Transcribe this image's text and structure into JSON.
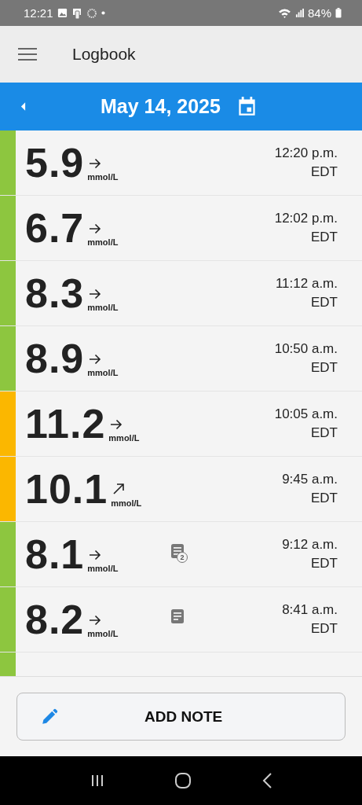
{
  "status_bar": {
    "time": "12:21",
    "battery": "84%"
  },
  "app_bar": {
    "title": "Logbook"
  },
  "date_bar": {
    "date": "May 14, 2025"
  },
  "readings": [
    {
      "kind": "full",
      "value": "5.9",
      "unit": "mmol/L",
      "trend": {
        "kind": "steady"
      },
      "time": "12:20 p.m.",
      "zone": "EDT",
      "color": "#8dc63f"
    },
    {
      "kind": "full",
      "value": "6.7",
      "unit": "mmol/L",
      "trend": {
        "kind": "steady"
      },
      "time": "12:02 p.m.",
      "zone": "EDT",
      "color": "#8dc63f"
    },
    {
      "kind": "full",
      "value": "8.3",
      "unit": "mmol/L",
      "trend": {
        "kind": "steady"
      },
      "time": "11:12 a.m.",
      "zone": "EDT",
      "color": "#8dc63f"
    },
    {
      "kind": "full",
      "value": "8.9",
      "unit": "mmol/L",
      "trend": {
        "kind": "steady"
      },
      "time": "10:50 a.m.",
      "zone": "EDT",
      "color": "#8dc63f"
    },
    {
      "kind": "full",
      "value": "11.2",
      "unit": "mmol/L",
      "trend": {
        "kind": "steady"
      },
      "time": "10:05 a.m.",
      "zone": "EDT",
      "color": "#fbb700"
    },
    {
      "kind": "full",
      "value": "10.1",
      "unit": "mmol/L",
      "trend": {
        "kind": "rising"
      },
      "time": "9:45 a.m.",
      "zone": "EDT",
      "color": "#fbb700"
    },
    {
      "kind": "full",
      "value": "8.1",
      "unit": "mmol/L",
      "trend": {
        "kind": "steady"
      },
      "note": true,
      "note_count": "2",
      "time": "9:12 a.m.",
      "zone": "EDT",
      "color": "#8dc63f"
    },
    {
      "kind": "full",
      "value": "8.2",
      "unit": "mmol/L",
      "trend": {
        "kind": "steady"
      },
      "note": true,
      "time": "8:41 a.m.",
      "zone": "EDT",
      "color": "#8dc63f"
    },
    {
      "kind": "partial",
      "color": "#8dc63f"
    }
  ],
  "add_note_button": {
    "label": "ADD NOTE"
  }
}
